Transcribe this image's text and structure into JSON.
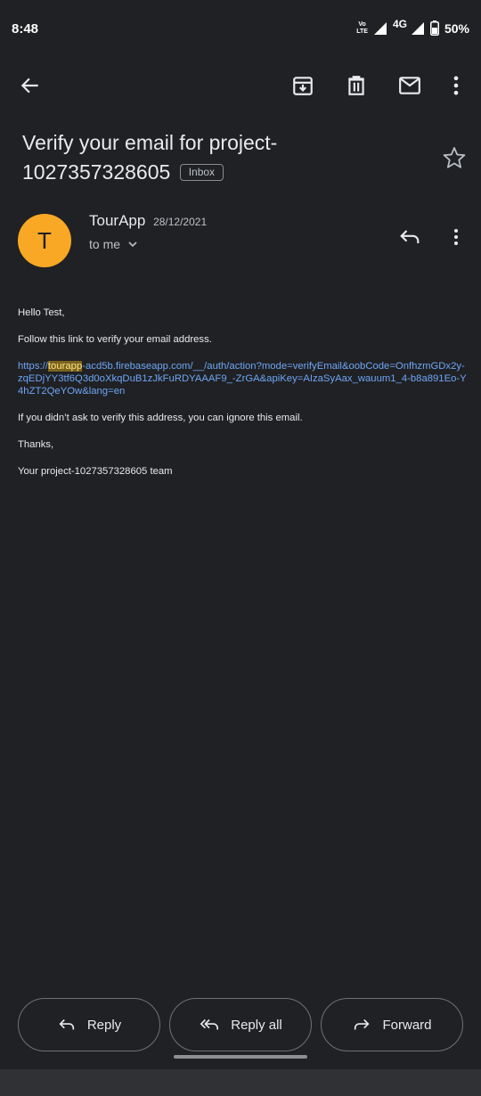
{
  "status_bar": {
    "time": "8:48",
    "volte_line1": "Vo",
    "volte_line2": "LTE",
    "network": "4G",
    "battery": "50%"
  },
  "toolbar": {
    "back_icon": "arrow-back-icon",
    "archive_icon": "archive-icon",
    "delete_icon": "trash-icon",
    "mark_unread_icon": "mail-icon",
    "more_icon": "more-vert-icon"
  },
  "email": {
    "subject": "Verify your email for project-1027357328605",
    "label": "Inbox",
    "sender": {
      "avatar_letter": "T",
      "avatar_color": "#f9a825",
      "name": "TourApp",
      "date": "28/12/2021",
      "recipient": "to me"
    },
    "body": {
      "greeting": "Hello Test,",
      "instruction": "Follow this link to verify your email address.",
      "link_prefix": "https://",
      "link_highlight": "tourapp",
      "link_rest": "-acd5b.firebaseapp.com/__/auth/action?mode=verifyEmail&oobCode=OnfhzmGDx2y-zqEDjYY3tf6Q3d0oXkqDuB1zJkFuRDYAAAF9_-ZrGA&apiKey=AIzaSyAax_wauum1_4-b8a891Eo-Y4hZT2QeYOw&lang=en",
      "ignore_note": "If you didn’t ask to verify this address, you can ignore this email.",
      "thanks": "Thanks,",
      "signature": "Your project-1027357328605 team"
    }
  },
  "actions": {
    "reply": "Reply",
    "reply_all": "Reply all",
    "forward": "Forward"
  },
  "colors": {
    "background": "#202124",
    "link": "#6ea6f5",
    "highlight": "#7a6320"
  }
}
